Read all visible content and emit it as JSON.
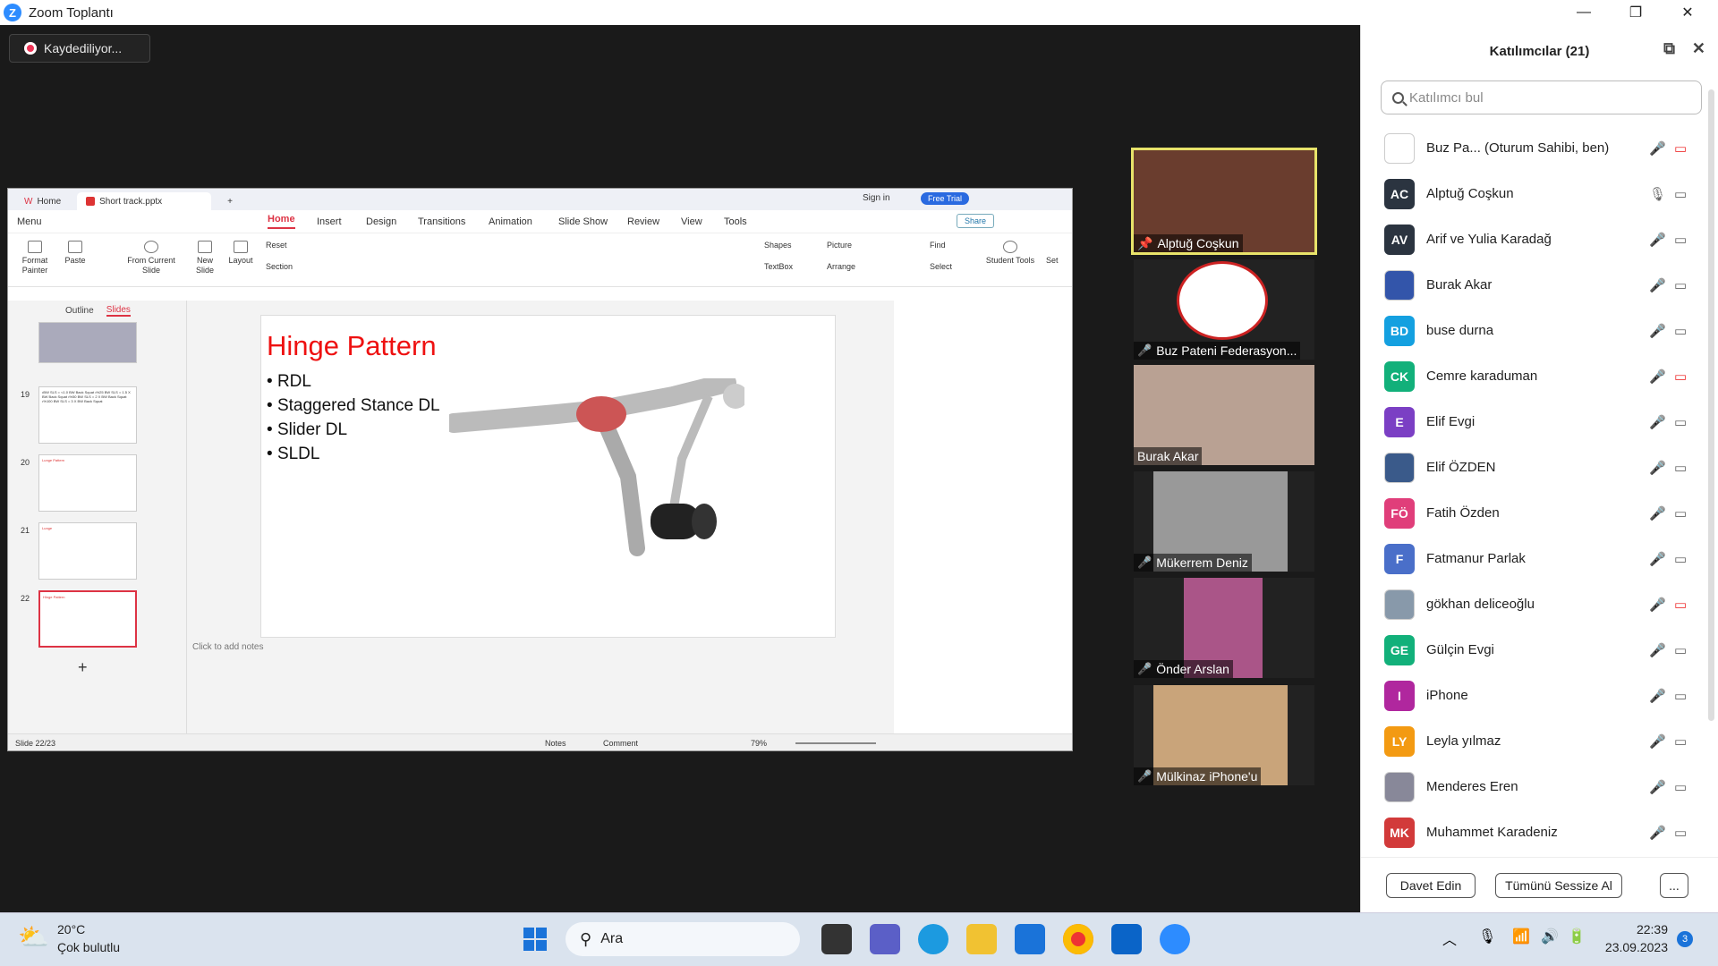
{
  "window": {
    "title": "Zoom Toplantı"
  },
  "recording": {
    "label": "Kaydediliyor..."
  },
  "presentation": {
    "tabs": [
      "Home",
      "Short track.pptx"
    ],
    "menu": [
      "Menu",
      "Home",
      "Insert",
      "Design",
      "Transitions",
      "Animation",
      "Slide Show",
      "Review",
      "View",
      "Tools"
    ],
    "sign_in": "Sign in",
    "free_trial": "Free Trial",
    "share": "Share",
    "ribbon": [
      "Format Painter",
      "Paste",
      "From Current Slide",
      "New Slide",
      "Layout",
      "Reset",
      "Section",
      "Shapes",
      "Picture",
      "TextBox",
      "Arrange",
      "Find",
      "Select",
      "Student Tools",
      "Set"
    ],
    "panel_tabs": [
      "Outline",
      "Slides"
    ],
    "thumbs": [
      {
        "num": "19",
        "text": "•BW SLS = <1.0 BW Back Squat •%25 BW SLS = 1.5 X BW Back Squat •%50 BW SLS = 2 X BW Back Squat •%100 BW SLS = 3 X BW Back Squat"
      },
      {
        "num": "20",
        "text": "Lunge Pattern"
      },
      {
        "num": "21",
        "text": "Lunge"
      },
      {
        "num": "22",
        "text": "Hinge Pattern"
      }
    ],
    "slide": {
      "title": "Hinge Pattern",
      "bullets": [
        "RDL",
        "Staggered Stance DL",
        "Slider DL",
        "SLDL"
      ]
    },
    "notes_placeholder": "Click to add notes",
    "status": {
      "slide": "Slide 22/23",
      "notes": "Notes",
      "comment": "Comment",
      "zoom": "79%"
    }
  },
  "videos": [
    {
      "name": "Alptuğ Coşkun",
      "icon": "pin-icon"
    },
    {
      "name": "Buz Pateni Federasyon...",
      "icon": "mic-muted-icon"
    },
    {
      "name": "Burak Akar",
      "icon": ""
    },
    {
      "name": "Mükerrem Deniz",
      "icon": "mic-muted-icon"
    },
    {
      "name": "Önder Arslan",
      "icon": "mic-muted-icon"
    },
    {
      "name": "Mülkinaz iPhone'u",
      "icon": "mic-muted-icon"
    }
  ],
  "participants": {
    "header": "Katılımcılar (21)",
    "search_placeholder": "Katılımcı bul",
    "list": [
      {
        "initials": "",
        "name": "Buz Pa... (Oturum Sahibi, ben)",
        "color": "#ffffff",
        "cam": "off"
      },
      {
        "initials": "AC",
        "name": "Alptuğ Coşkun",
        "color": "#2b3440",
        "cam": "on",
        "mic": "on"
      },
      {
        "initials": "AV",
        "name": "Arif ve Yulia Karadağ",
        "color": "#2b3440",
        "cam": "on"
      },
      {
        "initials": "",
        "name": "Burak Akar",
        "color": "#3355aa",
        "cam": "on"
      },
      {
        "initials": "BD",
        "name": "buse durna",
        "color": "#14a0e0",
        "cam": "on"
      },
      {
        "initials": "CK",
        "name": "Cemre karaduman",
        "color": "#12b07a",
        "cam": "off"
      },
      {
        "initials": "E",
        "name": "Elif Evgi",
        "color": "#7b3fc4",
        "cam": "on"
      },
      {
        "initials": "",
        "name": "Elif ÖZDEN",
        "color": "#3a5a8a",
        "cam": "on"
      },
      {
        "initials": "FÖ",
        "name": "Fatih Özden",
        "color": "#e03e7a",
        "cam": "on"
      },
      {
        "initials": "F",
        "name": "Fatmanur Parlak",
        "color": "#4a6fc9",
        "cam": "on"
      },
      {
        "initials": "",
        "name": "gökhan deliceoğlu",
        "color": "#8899aa",
        "cam": "off"
      },
      {
        "initials": "GE",
        "name": "Gülçin Evgi",
        "color": "#12b07a",
        "cam": "on"
      },
      {
        "initials": "I",
        "name": "iPhone",
        "color": "#b0279e",
        "cam": "on"
      },
      {
        "initials": "LY",
        "name": "Leyla yılmaz",
        "color": "#f39a12",
        "cam": "on"
      },
      {
        "initials": "",
        "name": "Menderes Eren",
        "color": "#889",
        "cam": "on"
      },
      {
        "initials": "MK",
        "name": "Muhammet Karadeniz",
        "color": "#d23a3a",
        "cam": "on"
      }
    ],
    "invite": "Davet Edin",
    "mute_all": "Tümünü Sessize Al",
    "more": "..."
  },
  "taskbar": {
    "temp": "20°C",
    "weather": "Çok bulutlu",
    "search": "Ara",
    "time": "22:39",
    "date": "23.09.2023",
    "badge": "3"
  }
}
